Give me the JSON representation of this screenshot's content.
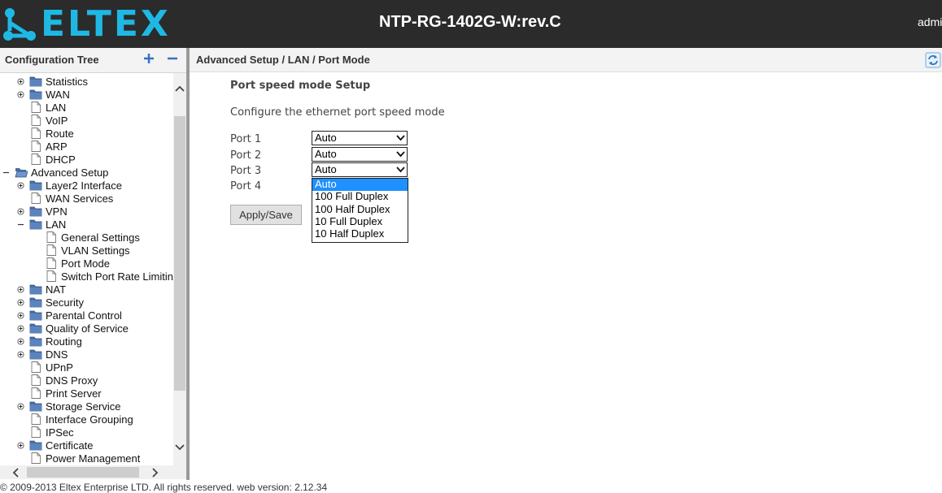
{
  "header": {
    "logo_text": "ELTEX",
    "device_title": "NTP-RG-1402G-W:rev.C",
    "user": "admi"
  },
  "tree": {
    "title": "Configuration Tree",
    "items": [
      {
        "label": "Statistics",
        "expand": "plus",
        "icon": "folder"
      },
      {
        "label": "WAN",
        "expand": "plus",
        "icon": "folder"
      },
      {
        "label": "LAN",
        "expand": "",
        "icon": "page"
      },
      {
        "label": "VoIP",
        "expand": "",
        "icon": "page"
      },
      {
        "label": "Route",
        "expand": "",
        "icon": "page"
      },
      {
        "label": "ARP",
        "expand": "",
        "icon": "page"
      },
      {
        "label": "DHCP",
        "expand": "",
        "icon": "page"
      },
      {
        "label": "Advanced Setup",
        "expand": "minus",
        "icon": "folder-open"
      },
      {
        "label": "Layer2 Interface",
        "expand": "plus",
        "icon": "folder"
      },
      {
        "label": "WAN Services",
        "expand": "",
        "icon": "page"
      },
      {
        "label": "VPN",
        "expand": "plus",
        "icon": "folder"
      },
      {
        "label": "LAN",
        "expand": "minus",
        "icon": "folder"
      },
      {
        "label": "General Settings",
        "expand": "",
        "icon": "page"
      },
      {
        "label": "VLAN Settings",
        "expand": "",
        "icon": "page"
      },
      {
        "label": "Port Mode",
        "expand": "",
        "icon": "page"
      },
      {
        "label": "Switch Port Rate Limiting",
        "expand": "",
        "icon": "page"
      },
      {
        "label": "NAT",
        "expand": "plus",
        "icon": "folder"
      },
      {
        "label": "Security",
        "expand": "plus",
        "icon": "folder"
      },
      {
        "label": "Parental Control",
        "expand": "plus",
        "icon": "folder"
      },
      {
        "label": "Quality of Service",
        "expand": "plus",
        "icon": "folder"
      },
      {
        "label": "Routing",
        "expand": "plus",
        "icon": "folder"
      },
      {
        "label": "DNS",
        "expand": "plus",
        "icon": "folder"
      },
      {
        "label": "UPnP",
        "expand": "",
        "icon": "page"
      },
      {
        "label": "DNS Proxy",
        "expand": "",
        "icon": "page"
      },
      {
        "label": "Print Server",
        "expand": "",
        "icon": "page"
      },
      {
        "label": "Storage Service",
        "expand": "plus",
        "icon": "folder"
      },
      {
        "label": "Interface Grouping",
        "expand": "",
        "icon": "page"
      },
      {
        "label": "IPSec",
        "expand": "",
        "icon": "page"
      },
      {
        "label": "Certificate",
        "expand": "plus",
        "icon": "folder"
      },
      {
        "label": "Power Management",
        "expand": "",
        "icon": "page"
      }
    ]
  },
  "main": {
    "breadcrumb": "Advanced Setup / LAN / Port Mode",
    "title": "Port speed mode Setup",
    "description": "Configure the ethernet port speed mode",
    "ports": [
      {
        "label": "Port 1",
        "value": "Auto"
      },
      {
        "label": "Port 2",
        "value": "Auto"
      },
      {
        "label": "Port 3",
        "value": "Auto"
      },
      {
        "label": "Port 4",
        "value": ""
      }
    ],
    "dropdown_options": [
      "Auto",
      "100 Full Duplex",
      "100 Half Duplex",
      "10 Full Duplex",
      "10 Half Duplex"
    ],
    "dropdown_selected": "Auto",
    "apply_label": "Apply/Save"
  },
  "footer": {
    "copyright": "© 2009-2013 Eltex Enterprise LTD. All rights reserved. web version: 2.12.34"
  },
  "colors": {
    "header_bg": "#2b2b2b",
    "logo": "#1fb8e4",
    "selected_option": "#1e90ff",
    "folder": "#4a6fa5"
  }
}
